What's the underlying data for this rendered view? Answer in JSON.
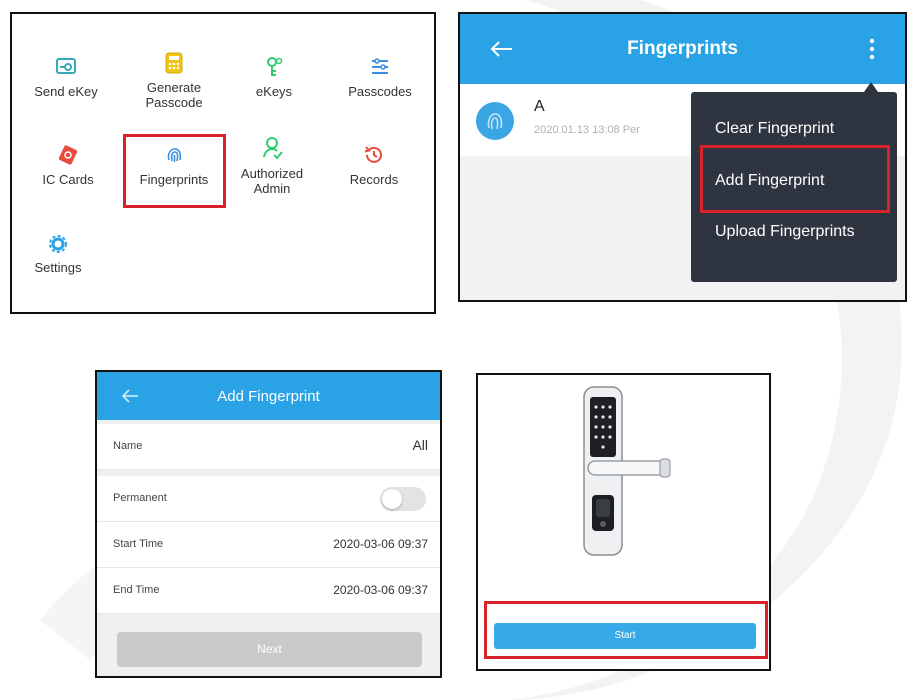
{
  "menu": {
    "items": [
      {
        "label": "Send eKey",
        "icon": "send-ekey-icon"
      },
      {
        "label": "Generate Passcode",
        "icon": "passcode-generator-icon"
      },
      {
        "label": "eKeys",
        "icon": "ekeys-icon"
      },
      {
        "label": "Passcodes",
        "icon": "passcodes-list-icon"
      },
      {
        "label": "IC Cards",
        "icon": "ic-card-icon"
      },
      {
        "label": "Fingerprints",
        "icon": "fingerprint-icon"
      },
      {
        "label": "Authorized Admin",
        "icon": "admin-user-icon"
      },
      {
        "label": "Records",
        "icon": "records-history-icon"
      },
      {
        "label": "Settings",
        "icon": "settings-gear-icon"
      }
    ]
  },
  "fingerprints_screen": {
    "title": "Fingerprints",
    "entry": {
      "name": "A",
      "meta": "2020.01.13 13:08  Per"
    },
    "dropdown": [
      "Clear Fingerprint",
      "Add Fingerprint",
      "Upload Fingerprints"
    ]
  },
  "add_fingerprint_screen": {
    "title": "Add Fingerprint",
    "fields": [
      {
        "label": "Name",
        "value": "All"
      },
      {
        "label": "Permanent",
        "value": ""
      },
      {
        "label": "Start Time",
        "value": "2020-03-06 09:37"
      },
      {
        "label": "End Time",
        "value": "2020-03-06 09:37"
      }
    ],
    "permanent_enabled": false,
    "next_label": "Next"
  },
  "lock_screen": {
    "start_label": "Start"
  },
  "colors": {
    "accent": "#29a3e6",
    "highlight": "#d8232a",
    "dropdown_bg": "#2f3540"
  }
}
